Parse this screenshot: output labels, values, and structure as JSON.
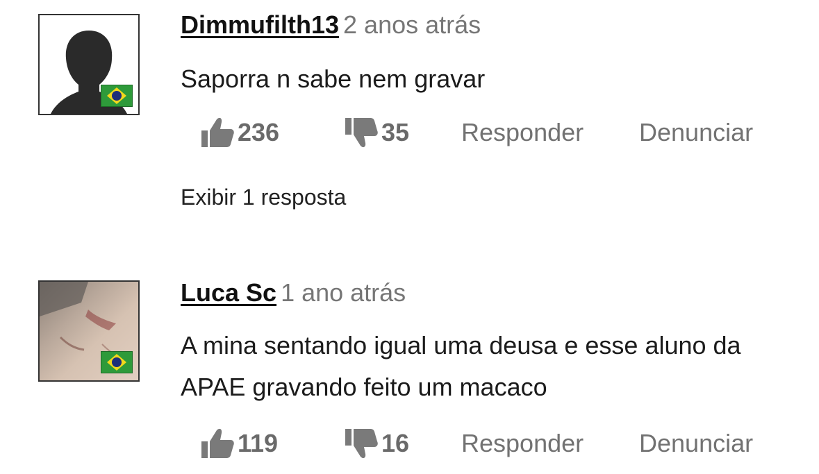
{
  "comments": [
    {
      "username": "Dimmufilth13",
      "timestamp": "2 anos atrás",
      "text": "Saporra n sabe nem gravar",
      "likes": "236",
      "dislikes": "35",
      "reply_label": "Responder",
      "report_label": "Denunciar",
      "show_replies": "Exibir 1 resposta",
      "avatar_icon": "silhouette-avatar",
      "flag_icon": "brazil-flag-icon"
    },
    {
      "username": "Luca Sc",
      "timestamp": "1 ano atrás",
      "text": "A mina sentando igual uma deusa e esse aluno da APAE gravando feito um macaco",
      "likes": "119",
      "dislikes": "16",
      "reply_label": "Responder",
      "report_label": "Denunciar",
      "avatar_icon": "photo-avatar",
      "flag_icon": "brazil-flag-icon"
    }
  ],
  "colors": {
    "text": "#222222",
    "muted": "#767676",
    "count": "#6a6a6a",
    "flag_green": "#2e9a3a",
    "flag_yellow": "#f2d81c",
    "flag_blue": "#1d2f7a"
  }
}
